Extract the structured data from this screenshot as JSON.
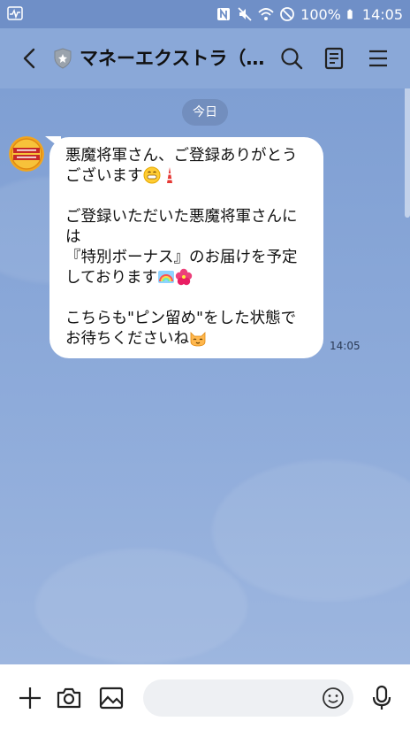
{
  "status_bar": {
    "battery_percent": "100%",
    "time": "14:05",
    "icons": [
      "activity-icon",
      "nfc-icon",
      "mute-icon",
      "wifi-icon",
      "no-sim-icon",
      "battery-icon"
    ]
  },
  "header": {
    "title": "マネーエクストラ（…",
    "icons": [
      "back-icon",
      "shield-icon",
      "search-icon",
      "notes-icon",
      "menu-icon"
    ]
  },
  "chat": {
    "date_label": "今日",
    "message": {
      "lines": [
        "悪魔将軍さん、ご登録ありがとう",
        "ございます",
        "",
        "ご登録いただいた悪魔将軍さんに",
        "は",
        "『特別ボーナス』のお届けを予定",
        "しております",
        "",
        "こちらも\"ピン留め\"をした状態で",
        "お待ちくださいね"
      ],
      "time": "14:05",
      "emojis": [
        "grinning-emoji",
        "tokyo-tower-emoji",
        "rainbow-emoji",
        "hibiscus-emoji",
        "cat-emoji"
      ]
    }
  },
  "input_bar": {
    "placeholder": "",
    "icons": [
      "plus-icon",
      "camera-icon",
      "image-icon",
      "emoji-icon",
      "mic-icon"
    ]
  },
  "colors": {
    "chat_background": "#8aa8d8",
    "status_bar": "#6f8fc7",
    "bubble": "#ffffff",
    "input_bar": "#ffffff"
  }
}
